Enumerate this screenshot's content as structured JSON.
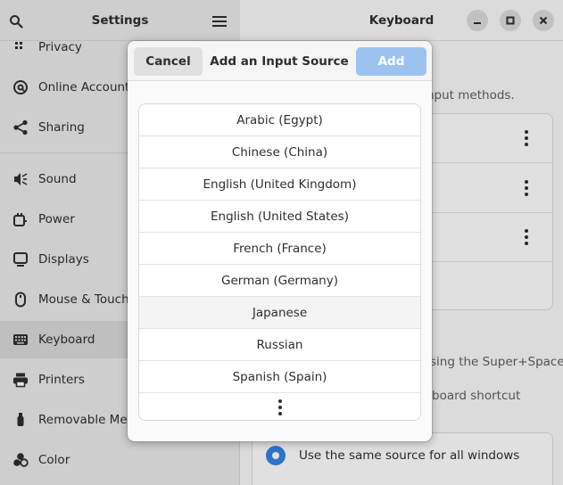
{
  "sidebar": {
    "title": "Settings",
    "search_icon": "search-icon",
    "menu_icon": "hamburger-menu-icon",
    "items": [
      {
        "label": "Privacy",
        "icon": "privacy-icon"
      },
      {
        "label": "Online Accounts",
        "icon": "online-accounts-icon"
      },
      {
        "label": "Sharing",
        "icon": "sharing-icon"
      },
      {
        "label": "Sound",
        "icon": "sound-icon"
      },
      {
        "label": "Power",
        "icon": "power-icon"
      },
      {
        "label": "Displays",
        "icon": "displays-icon"
      },
      {
        "label": "Mouse & Touchpad",
        "icon": "mouse-icon"
      },
      {
        "label": "Keyboard",
        "icon": "keyboard-icon",
        "active": true
      },
      {
        "label": "Printers",
        "icon": "printer-icon"
      },
      {
        "label": "Removable Media",
        "icon": "usb-icon"
      },
      {
        "label": "Color",
        "icon": "color-icon"
      }
    ]
  },
  "content": {
    "title": "Keyboard",
    "window_buttons": [
      "minimize-icon",
      "maximize-icon",
      "close-icon"
    ],
    "text_input_methods": "nput methods.",
    "text_super_space": "sing the Super+Space",
    "text_keyboard_shortcut": "board shortcut",
    "radio_label": "Use the same source for all windows"
  },
  "dialog": {
    "cancel_label": "Cancel",
    "title": "Add an Input Source",
    "add_label": "Add",
    "languages": [
      "Arabic (Egypt)",
      "Chinese (China)",
      "English (United Kingdom)",
      "English (United States)",
      "French (France)",
      "German (Germany)",
      "Japanese",
      "Russian",
      "Spanish (Spain)"
    ],
    "more_icon": "more-options-icon"
  },
  "colors": {
    "accent": "#3584e4",
    "add_button_disabled": "#9cc3ef"
  }
}
